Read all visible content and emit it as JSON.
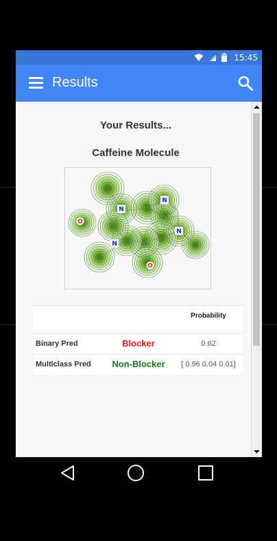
{
  "status_bar": {
    "time": "15:45"
  },
  "app_bar": {
    "title": "Results"
  },
  "content": {
    "results_heading": "Your Results...",
    "molecule_heading": "Caffeine Molecule",
    "molecule_atoms": [
      "O",
      "N",
      "N",
      "N",
      "N",
      "O"
    ],
    "table": {
      "header_probability": "Probability",
      "rows": [
        {
          "label": "Binary Pred",
          "prediction": "Blocker",
          "probability": "0.62",
          "color": "#e31a1a"
        },
        {
          "label": "Multiclass Pred",
          "prediction": "Non-Blocker",
          "probability": "[ 0.96 0.04 0.01]",
          "color": "#1c7a1c"
        }
      ]
    }
  },
  "colors": {
    "status_bar": "#3775d8",
    "app_bar": "#4285f4",
    "contour_green": "#2e7d12",
    "atom_O": "#e41a1a",
    "atom_N": "#1a1ad9"
  }
}
